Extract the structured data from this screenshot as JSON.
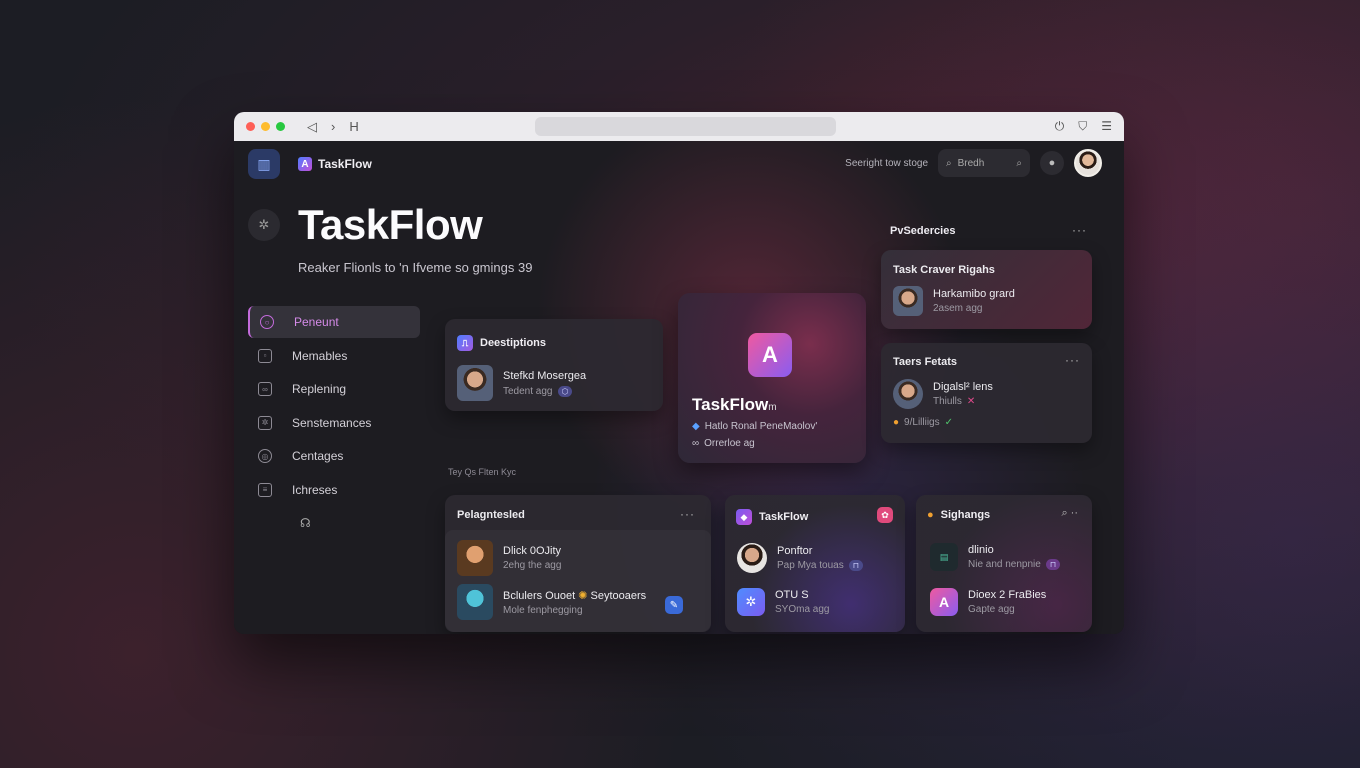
{
  "browser": {
    "nav_back": "◁",
    "nav_forward": "›",
    "nav_home": "H"
  },
  "app": {
    "brand_name": "TaskFlow",
    "top_hint": "Seeright tow stoge",
    "search_placeholder": "Bredh"
  },
  "hero": {
    "title": "TaskFlow",
    "subtitle": "Reaker Flionls to 'n Ifveme so gmings 39"
  },
  "sidebar": {
    "items": [
      {
        "label": "Peneunt",
        "icon": "chat-icon",
        "active": true
      },
      {
        "label": "Memables",
        "icon": "image-icon"
      },
      {
        "label": "Replening",
        "icon": "gamepad-icon"
      },
      {
        "label": "Senstemances",
        "icon": "gear-icon"
      },
      {
        "label": "Centages",
        "icon": "target-icon"
      },
      {
        "label": "Ichreses",
        "icon": "list-icon"
      }
    ]
  },
  "descriptions_card": {
    "title": "Deestiptions",
    "item_title": "Stefkd Mosergea",
    "item_meta": "Tedent agg"
  },
  "feature_card": {
    "name": "TaskFlow",
    "suffix": "m",
    "line1": "Hatlo Ronal PeneMaolov'",
    "line2": "Orrerloe ag"
  },
  "filter_label": "Tey Qs Flten Kyc",
  "right_panel": {
    "title": "PvSedercies",
    "card1_title": "Task Craver Rigahs",
    "card1_item": "Harkamibo grard",
    "card1_meta": "2asem agg",
    "card2_title": "Taers Fetats",
    "card2_item": "Digalsl² lens",
    "card2_meta": "Thiulls",
    "card2_extra": "9/Lilliigs"
  },
  "bottom_cards": {
    "left": {
      "title": "Pelagntesled",
      "item1_title": "Dlick 0OJity",
      "item1_meta": "2ehg the agg",
      "item2_title": "Bclulers Ouoet",
      "item2_extra": "Seytooaers",
      "item2_meta": "Mole fenphegging"
    },
    "middle": {
      "title": "TaskFlow",
      "item1_title": "Ponftor",
      "item1_meta": "Pap Mya touas",
      "item2_title": "OTU S",
      "item2_meta": "SYOma agg"
    },
    "right": {
      "title": "Sighangs",
      "item1_title": "dlinio",
      "item1_meta": "Nie and nenpnie",
      "item2_title": "Dioex 2 FraBies",
      "item2_meta": "Gapte agg"
    }
  },
  "colors": {
    "accent": "#c36bdb",
    "brand_gradient_start": "#ef5aa0",
    "brand_gradient_end": "#8a5cf0"
  }
}
